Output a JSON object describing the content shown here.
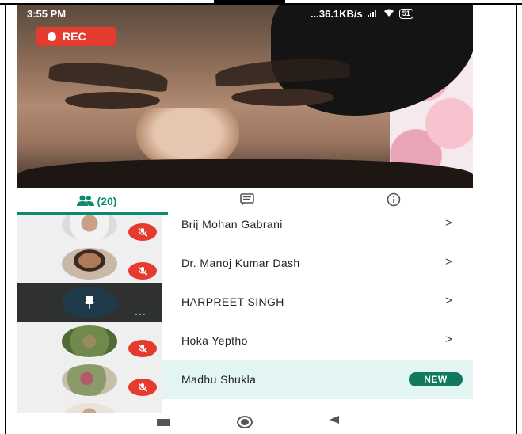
{
  "status_bar": {
    "time": "3:55 PM",
    "network_speed": "...36.1KB/s",
    "battery": "51"
  },
  "recording": {
    "label": "REC"
  },
  "tabs": {
    "participants_count": "(20)",
    "active": "participants"
  },
  "participants": [
    {
      "name": "Brij Mohan Gabrani",
      "muted": true,
      "action": ">"
    },
    {
      "name": "Dr. Manoj Kumar Dash",
      "muted": true,
      "action": ">"
    },
    {
      "name": "HARPREET SINGH",
      "pinned": true,
      "more": "...",
      "action": ">"
    },
    {
      "name": "Hoka Yeptho",
      "muted": true,
      "action": ">"
    },
    {
      "name": "Madhu Shukla",
      "muted": true,
      "badge": "NEW"
    }
  ],
  "colors": {
    "accent": "#0b8a70",
    "rec": "#e43b2e",
    "new_badge": "#117a5e",
    "highlight_row": "#e3f5f2"
  },
  "icons": {
    "tab_people": "people-icon",
    "tab_chat": "chat-icon",
    "tab_info": "info-icon",
    "mute": "mic-off-icon",
    "pin": "pin-icon"
  }
}
